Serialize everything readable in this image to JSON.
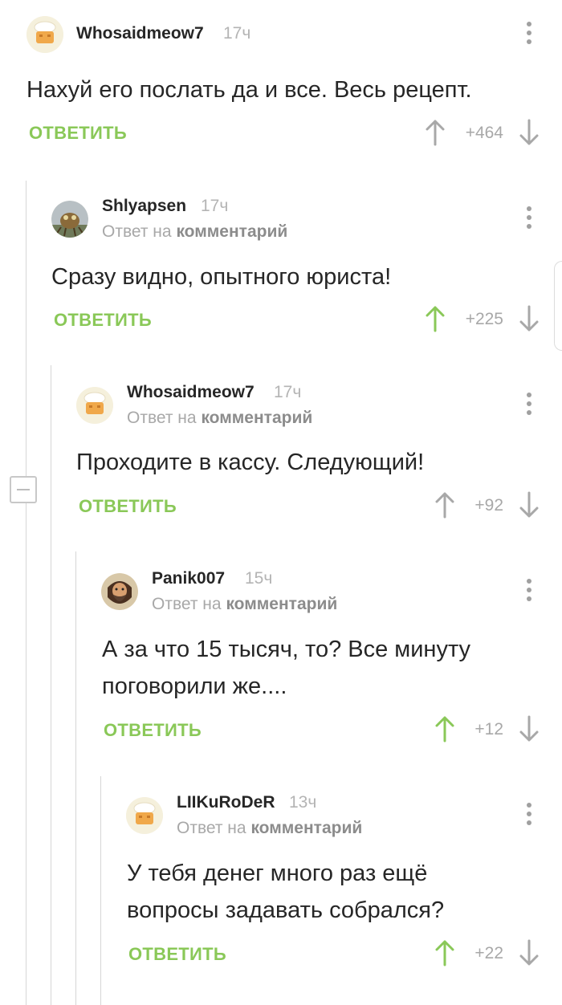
{
  "reply_label": "ОТВЕТИТЬ",
  "comments": [
    {
      "username": "Whosaidmeow7",
      "time": "17ч",
      "reply_prefix": "",
      "reply_target": "",
      "text": "Нахуй его послать да и все. Весь рецепт.",
      "rating": "+464",
      "up_color": "#a8a8a8",
      "avatar": "cookpot-avatar"
    },
    {
      "username": "Shlyapsen",
      "time": "17ч",
      "reply_prefix": "Ответ на",
      "reply_target": "комментарий",
      "text": "Сразу видно, опытного юриста!",
      "rating": "+225",
      "up_color": "#8ac858",
      "avatar": "creature-avatar"
    },
    {
      "username": "Whosaidmeow7",
      "time": "17ч",
      "reply_prefix": "Ответ на",
      "reply_target": "комментарий",
      "text": "Проходите в кассу. Следующий!",
      "rating": "+92",
      "up_color": "#a8a8a8",
      "avatar": "cookpot-avatar"
    },
    {
      "username": "Panik007",
      "time": "15ч",
      "reply_prefix": "Ответ на",
      "reply_target": "комментарий",
      "text_line1": "А за что 15 тысяч, то? Все минуту",
      "text_line2": "поговорили же....",
      "rating": "+12",
      "up_color": "#8ac858",
      "avatar": "bearded-man-avatar"
    },
    {
      "username": "LIIKuRoDeR",
      "time": "13ч",
      "reply_prefix": "Ответ на",
      "reply_target": "комментарий",
      "text_line1": "У тебя денег много раз ещё",
      "text_line2": "вопросы задавать собрался?",
      "rating": "+22",
      "up_color": "#8ac858",
      "avatar": "cookpot-avatar"
    }
  ],
  "colors": {
    "accent_green": "#8ac858",
    "muted": "#a8a8a8",
    "text": "#262626",
    "thread_line": "#d6d6d6"
  },
  "icons": [
    "more-options-icon",
    "upvote-icon",
    "downvote-icon",
    "collapse-thread-icon"
  ]
}
